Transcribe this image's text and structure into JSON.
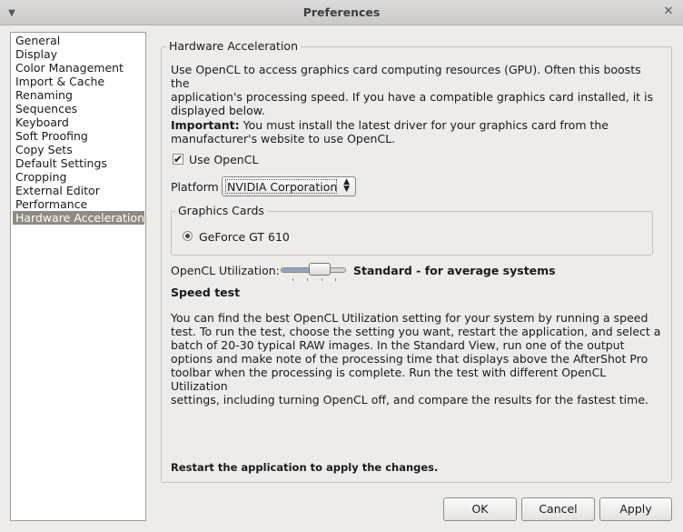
{
  "window": {
    "title": "Preferences"
  },
  "sidebar": {
    "items": [
      {
        "label": "General"
      },
      {
        "label": "Display"
      },
      {
        "label": "Color Management"
      },
      {
        "label": "Import & Cache"
      },
      {
        "label": "Renaming"
      },
      {
        "label": "Sequences"
      },
      {
        "label": "Keyboard"
      },
      {
        "label": "Soft Proofing"
      },
      {
        "label": "Copy Sets"
      },
      {
        "label": "Default Settings"
      },
      {
        "label": "Cropping"
      },
      {
        "label": "External Editor"
      },
      {
        "label": "Performance"
      },
      {
        "label": "Hardware Acceleration",
        "selected": true
      }
    ]
  },
  "main": {
    "group_title": "Hardware Acceleration",
    "intro_line1": "Use OpenCL to access graphics card computing resources (GPU). Often this boosts the",
    "intro_line2": "application's processing speed. If you have a compatible graphics card installed, it is",
    "intro_line3": "displayed below.",
    "important_label": "Important:",
    "important_line1": " You must install the latest driver for your graphics card from the",
    "important_line2": "manufacturer's website to use OpenCL.",
    "use_opencl": {
      "label": "Use OpenCL",
      "checked": true,
      "check_glyph": "✔"
    },
    "platform": {
      "label": "Platform",
      "value": "NVIDIA Corporation"
    },
    "graphics_cards": {
      "title": "Graphics Cards",
      "cards": [
        {
          "label": "GeForce GT 610",
          "selected": true
        }
      ]
    },
    "utilization": {
      "label": "OpenCL Utilization:",
      "value_text": "Standard - for average systems",
      "level": 0.5
    },
    "speed_test": {
      "title": "Speed test",
      "lines": [
        "You can find the best OpenCL Utilization setting for your system by running a speed",
        "test. To run the test, choose the setting you want, restart the application, and select a",
        "batch of 20-30 typical RAW images. In the Standard View, run one of the output",
        "options and make note of the processing time that displays above the AfterShot Pro",
        "toolbar when the processing is complete. Run the test with different OpenCL Utilization",
        "settings, including turning OpenCL off, and compare the results for the fastest time."
      ]
    },
    "restart_note": "Restart the application to apply the changes."
  },
  "buttons": {
    "ok": "OK",
    "cancel": "Cancel",
    "apply": "Apply"
  },
  "colors": {
    "selection": "#8f8a82",
    "window_bg": "#edeceb"
  }
}
